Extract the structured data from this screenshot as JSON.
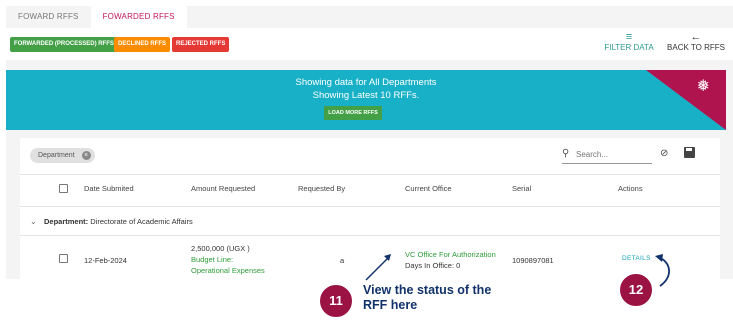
{
  "tabs": [
    {
      "label": "FOWARD RFFS"
    },
    {
      "label": "FOWARDED RFFS"
    }
  ],
  "toolbar": {
    "status_buttons": [
      {
        "label": "FORWARDED (PROCESSED) RFFS",
        "color": "#43a047"
      },
      {
        "label": "DECLINED RFFS",
        "color": "#fb8c00"
      },
      {
        "label": "REJECTED RFFS",
        "color": "#e53935"
      }
    ],
    "filter_label": "FILTER DATA",
    "back_label": "BACK TO RFFS"
  },
  "banner": {
    "line1": "Showing data for All Departments",
    "line2": "Showing Latest 10 RFFs.",
    "load_more": "LOAD MORE RFFS",
    "color": "#18b0c6",
    "accent": "#b0144f"
  },
  "filter_chip": {
    "label": "Department"
  },
  "search": {
    "placeholder": "Search..."
  },
  "table": {
    "columns": [
      "Date Submited",
      "Amount Requested",
      "Requested By",
      "Current Office",
      "Serial",
      "Actions"
    ],
    "group": {
      "prefix": "Department:",
      "name": "Directorate of Academic Affairs"
    },
    "rows": [
      {
        "date": "12-Feb-2024",
        "amount": "2,500,000 (UGX )",
        "budget_line_label": "Budget Line:",
        "budget_line": "Operational Expenses",
        "requested_by": "a",
        "office": "VC Office For Authorization",
        "days_in_office": "Days In Office: 0",
        "serial": "1090897081",
        "action": "DETAILS"
      }
    ]
  },
  "annotations": {
    "badge_11": "11",
    "badge_12": "12",
    "callout": "View the status of the RFF here",
    "color": "#9b1342"
  }
}
